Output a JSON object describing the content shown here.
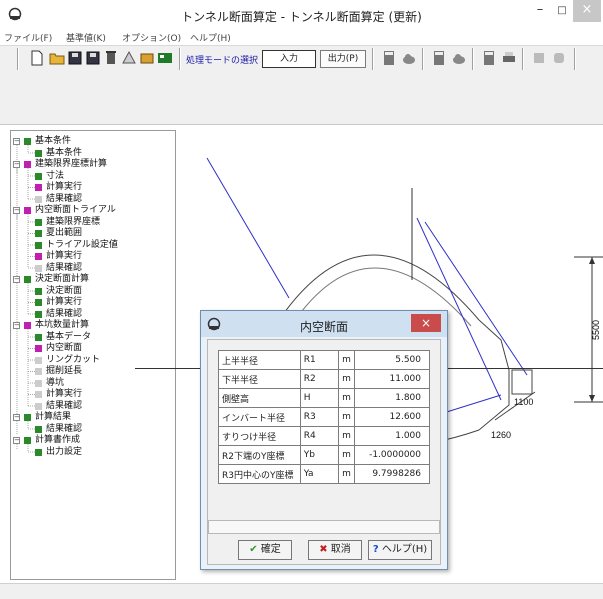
{
  "window": {
    "title": "トンネル断面算定 - トンネル断面算定 (更新)",
    "minimize": "–",
    "maximize": "□",
    "close": "×"
  },
  "menu": [
    {
      "label": "ファイル(F)"
    },
    {
      "label": "基準値(K)"
    },
    {
      "label": "オプション(O)"
    },
    {
      "label": "ヘルプ(H)"
    }
  ],
  "toolbar": {
    "mode_label": "処理モードの選択",
    "input_label": "入力",
    "output_label": "出力(P)",
    "icons": [
      "new-file-icon",
      "open-folder-icon",
      "save-icon",
      "save-as-icon",
      "delete-icon",
      "tool-a-icon",
      "tool-b-icon",
      "tool-c-icon",
      "calc-icon",
      "cloud-icon",
      "calc-2-icon",
      "cloud-2-icon",
      "calc-3-icon",
      "print-icon",
      "stop-icon",
      "stop-2-icon"
    ]
  },
  "tree": [
    {
      "label": "基本条件",
      "level": 0,
      "expander": "−",
      "color": "#2a8a2a"
    },
    {
      "label": "基本条件",
      "level": 1,
      "color": "#2a8a2a"
    },
    {
      "label": "建築限界座標計算",
      "level": 0,
      "expander": "−",
      "color": "#c020b0"
    },
    {
      "label": "寸法",
      "level": 1,
      "color": "#2a8a2a"
    },
    {
      "label": "計算実行",
      "level": 1,
      "color": "#c020b0"
    },
    {
      "label": "結果確認",
      "level": 1,
      "color": "#cccccc"
    },
    {
      "label": "内空断面トライアル",
      "level": 0,
      "expander": "−",
      "color": "#c020b0"
    },
    {
      "label": "建築限界座標",
      "level": 1,
      "color": "#2a8a2a"
    },
    {
      "label": "夏出範囲",
      "level": 1,
      "color": "#2a8a2a"
    },
    {
      "label": "トライアル設定値",
      "level": 1,
      "color": "#2a8a2a"
    },
    {
      "label": "計算実行",
      "level": 1,
      "color": "#c020b0"
    },
    {
      "label": "結果確認",
      "level": 1,
      "color": "#cccccc"
    },
    {
      "label": "決定断面計算",
      "level": 0,
      "expander": "−",
      "color": "#2a8a2a"
    },
    {
      "label": "決定断面",
      "level": 1,
      "color": "#2a8a2a"
    },
    {
      "label": "計算実行",
      "level": 1,
      "color": "#2a8a2a"
    },
    {
      "label": "結果確認",
      "level": 1,
      "color": "#2a8a2a"
    },
    {
      "label": "本坑数量計算",
      "level": 0,
      "expander": "−",
      "color": "#c020b0"
    },
    {
      "label": "基本データ",
      "level": 1,
      "color": "#2a8a2a"
    },
    {
      "label": "内空断面",
      "level": 1,
      "color": "#c020b0"
    },
    {
      "label": "リングカット",
      "level": 1,
      "color": "#cccccc"
    },
    {
      "label": "掘削延長",
      "level": 1,
      "color": "#cccccc"
    },
    {
      "label": "導坑",
      "level": 1,
      "color": "#cccccc"
    },
    {
      "label": "計算実行",
      "level": 1,
      "color": "#cccccc"
    },
    {
      "label": "結果確認",
      "level": 1,
      "color": "#cccccc"
    },
    {
      "label": "計算結果",
      "level": 0,
      "expander": "−",
      "color": "#2a8a2a"
    },
    {
      "label": "結果確認",
      "level": 1,
      "color": "#2a8a2a"
    },
    {
      "label": "計算書作成",
      "level": 0,
      "expander": "−",
      "color": "#2a8a2a"
    },
    {
      "label": "出力設定",
      "level": 1,
      "color": "#2a8a2a"
    }
  ],
  "drawing": {
    "dim_5500": "5500",
    "dim_1100": "1100",
    "dim_1260": "1260"
  },
  "dialog": {
    "title": "内空断面",
    "close": "×",
    "rows": [
      {
        "name": "上半半径",
        "sym": "R1",
        "unit": "m",
        "value": "5.500"
      },
      {
        "name": "下半半径",
        "sym": "R2",
        "unit": "m",
        "value": "11.000"
      },
      {
        "name": "側壁高",
        "sym": "H",
        "unit": "m",
        "value": "1.800"
      },
      {
        "name": "インバート半径",
        "sym": "R3",
        "unit": "m",
        "value": "12.600"
      },
      {
        "name": "すりつけ半径",
        "sym": "R4",
        "unit": "m",
        "value": "1.000"
      },
      {
        "name": "R2下端のY座標",
        "sym": "Yb",
        "unit": "m",
        "value": "-1.0000000"
      },
      {
        "name": "R3円中心のY座標",
        "sym": "Ya",
        "unit": "m",
        "value": "9.7998286"
      }
    ],
    "ok_label": "確定",
    "cancel_label": "取消",
    "help_label": "ヘルプ(H)",
    "ok_icon": "✔",
    "cancel_icon": "✖",
    "help_icon": "?"
  }
}
